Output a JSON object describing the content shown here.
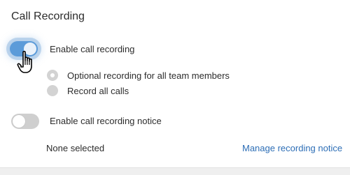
{
  "section": {
    "title": "Call Recording"
  },
  "recording_toggle": {
    "label": "Enable call recording",
    "state": "on",
    "color": "#5b9bd9"
  },
  "recording_options": [
    {
      "label": "Optional recording for all team members",
      "selected": true
    },
    {
      "label": "Record all calls",
      "selected": false
    }
  ],
  "notice_toggle": {
    "label": "Enable call recording notice",
    "state": "off"
  },
  "notice": {
    "status": "None selected",
    "manage_link": "Manage recording notice",
    "link_color": "#2d6eb6"
  },
  "cursor": {
    "icon": "hand-pointer-icon"
  }
}
